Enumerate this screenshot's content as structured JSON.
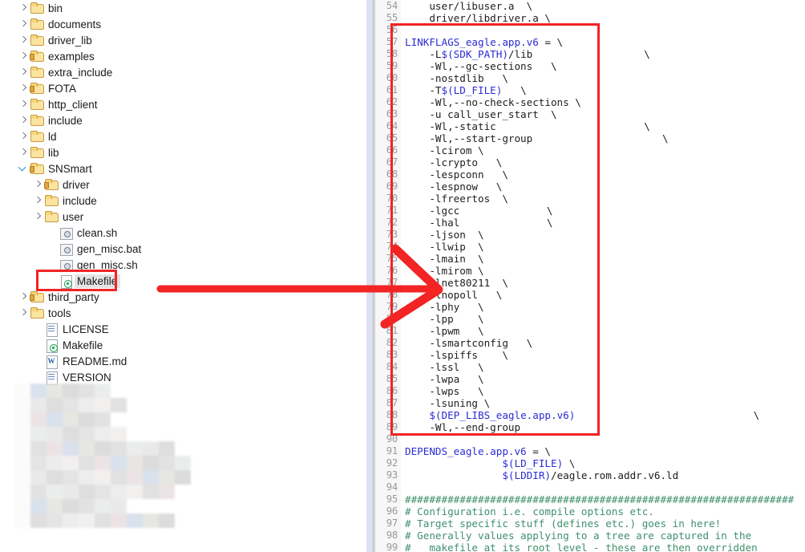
{
  "file_tree": {
    "name": "project-file-tree",
    "items": [
      {
        "label": "bin",
        "indent": 1,
        "icon": "folder-icon",
        "twisty": "closed",
        "selected": false
      },
      {
        "label": "documents",
        "indent": 1,
        "icon": "folder-icon",
        "twisty": "closed",
        "selected": false
      },
      {
        "label": "driver_lib",
        "indent": 1,
        "icon": "folder-icon",
        "twisty": "closed",
        "selected": false
      },
      {
        "label": "examples",
        "indent": 1,
        "icon": "folder-open-icon",
        "twisty": "closed",
        "selected": false
      },
      {
        "label": "extra_include",
        "indent": 1,
        "icon": "folder-icon",
        "twisty": "closed",
        "selected": false
      },
      {
        "label": "FOTA",
        "indent": 1,
        "icon": "folder-open-icon",
        "twisty": "closed",
        "selected": false
      },
      {
        "label": "http_client",
        "indent": 1,
        "icon": "folder-icon",
        "twisty": "closed",
        "selected": false
      },
      {
        "label": "include",
        "indent": 1,
        "icon": "folder-icon",
        "twisty": "closed",
        "selected": false
      },
      {
        "label": "ld",
        "indent": 1,
        "icon": "folder-icon",
        "twisty": "closed",
        "selected": false
      },
      {
        "label": "lib",
        "indent": 1,
        "icon": "folder-icon",
        "twisty": "closed",
        "selected": false
      },
      {
        "label": "SNSmart",
        "indent": 1,
        "icon": "folder-open-icon",
        "twisty": "open",
        "selected": false
      },
      {
        "label": "driver",
        "indent": 2,
        "icon": "folder-open-icon",
        "twisty": "closed",
        "selected": false
      },
      {
        "label": "include",
        "indent": 2,
        "icon": "folder-icon",
        "twisty": "closed",
        "selected": false
      },
      {
        "label": "user",
        "indent": 2,
        "icon": "folder-icon",
        "twisty": "closed",
        "selected": false
      },
      {
        "label": "clean.sh",
        "indent": 3,
        "icon": "script-icon",
        "twisty": "none",
        "selected": false
      },
      {
        "label": "gen_misc.bat",
        "indent": 3,
        "icon": "script-icon",
        "twisty": "none",
        "selected": false
      },
      {
        "label": "gen_misc.sh",
        "indent": 3,
        "icon": "script-icon",
        "twisty": "none",
        "selected": false
      },
      {
        "label": "Makefile",
        "indent": 3,
        "icon": "makefile-icon",
        "twisty": "none",
        "selected": true
      },
      {
        "label": "third_party",
        "indent": 1,
        "icon": "folder-open-icon",
        "twisty": "closed",
        "selected": false
      },
      {
        "label": "tools",
        "indent": 1,
        "icon": "folder-icon",
        "twisty": "closed",
        "selected": false
      },
      {
        "label": "LICENSE",
        "indent": 2,
        "icon": "document-icon",
        "twisty": "none",
        "selected": false
      },
      {
        "label": "Makefile",
        "indent": 2,
        "icon": "makefile-icon",
        "twisty": "none",
        "selected": false
      },
      {
        "label": "README.md",
        "indent": 2,
        "icon": "markdown-icon",
        "twisty": "none",
        "selected": false
      },
      {
        "label": "VERSION",
        "indent": 2,
        "icon": "document-icon",
        "twisty": "none",
        "selected": false
      }
    ]
  },
  "annotations": {
    "highlight_color": "#f22424",
    "makefile_box_label": "Makefile",
    "arrow_label": "pointer-arrow-to-lnopoll"
  },
  "editor": {
    "name": "makefile-source-view",
    "language": "makefile",
    "first_visible_line": 54,
    "last_visible_line": 99,
    "lines": [
      {
        "n": 54,
        "text": "    user/libuser.a  \\"
      },
      {
        "n": 55,
        "text": "    driver/libdriver.a \\"
      },
      {
        "n": 56,
        "text": ""
      },
      {
        "n": 57,
        "text": "LINKFLAGS_eagle.app.v6 = \\",
        "kw_end": 22
      },
      {
        "n": 58,
        "text": "    -L$(SDK_PATH)/lib",
        "cont": "\\",
        "cont_col": 40
      },
      {
        "n": 59,
        "text": "    -Wl,--gc-sections   \\"
      },
      {
        "n": 60,
        "text": "    -nostdlib   \\"
      },
      {
        "n": 61,
        "text": "    -T$(LD_FILE)   \\"
      },
      {
        "n": 62,
        "text": "    -Wl,--no-check-sections \\"
      },
      {
        "n": 63,
        "text": "    -u call_user_start  \\"
      },
      {
        "n": 64,
        "text": "    -Wl,-static",
        "cont": "\\",
        "cont_col": 40
      },
      {
        "n": 65,
        "text": "    -Wl,--start-group",
        "cont": "\\",
        "cont_col": 43
      },
      {
        "n": 66,
        "text": "    -lcirom \\"
      },
      {
        "n": 67,
        "text": "    -lcrypto   \\"
      },
      {
        "n": 68,
        "text": "    -lespconn   \\"
      },
      {
        "n": 69,
        "text": "    -lespnow   \\"
      },
      {
        "n": 70,
        "text": "    -lfreertos  \\"
      },
      {
        "n": 71,
        "text": "    -lgcc",
        "cont": "\\",
        "cont_col": 24
      },
      {
        "n": 72,
        "text": "    -lhal",
        "cont": "\\",
        "cont_col": 24
      },
      {
        "n": 73,
        "text": "    -ljson  \\"
      },
      {
        "n": 74,
        "text": "    -llwip  \\"
      },
      {
        "n": 75,
        "text": "    -lmain  \\"
      },
      {
        "n": 76,
        "text": "    -lmirom \\"
      },
      {
        "n": 77,
        "text": "    -lnet80211  \\"
      },
      {
        "n": 78,
        "text": "    -lnopoll   \\"
      },
      {
        "n": 79,
        "text": "    -lphy   \\"
      },
      {
        "n": 80,
        "text": "    -lpp    \\"
      },
      {
        "n": 81,
        "text": "    -lpwm   \\"
      },
      {
        "n": 82,
        "text": "    -lsmartconfig   \\"
      },
      {
        "n": 83,
        "text": "    -lspiffs    \\"
      },
      {
        "n": 84,
        "text": "    -lssl   \\"
      },
      {
        "n": 85,
        "text": "    -lwpa   \\"
      },
      {
        "n": 86,
        "text": "    -lwps   \\"
      },
      {
        "n": 87,
        "text": "    -lsuning \\"
      },
      {
        "n": 88,
        "text": "    $(DEP_LIBS_eagle.app.v6)",
        "var": true,
        "cont": "\\",
        "cont_col": 58
      },
      {
        "n": 89,
        "text": "    -Wl,--end-group"
      },
      {
        "n": 90,
        "text": ""
      },
      {
        "n": 91,
        "text": "DEPENDS_eagle.app.v6 = \\",
        "kw_end": 20
      },
      {
        "n": 92,
        "text": "                $(LD_FILE) \\",
        "var": true
      },
      {
        "n": 93,
        "text": "                $(LDDIR)/eagle.rom.addr.v6.ld",
        "var": true
      },
      {
        "n": 94,
        "text": ""
      },
      {
        "n": 95,
        "text": "################################################################",
        "comment": true
      },
      {
        "n": 96,
        "text": "# Configuration i.e. compile options etc.",
        "comment": true
      },
      {
        "n": 97,
        "text": "# Target specific stuff (defines etc.) goes in here!",
        "comment": true
      },
      {
        "n": 98,
        "text": "# Generally values applying to a tree are captured in the",
        "comment": true
      },
      {
        "n": 99,
        "text": "#   makefile at its root level - these are then overridden",
        "comment": true
      }
    ]
  },
  "colors": {
    "keyword": "#2b2bd4",
    "variable": "#2b2bd4",
    "comment": "#3f8f6e",
    "line_number": "#9a9a9a",
    "text": "#1d1d1d",
    "annotation_red": "#f22424",
    "selection": "#e4e4e4"
  }
}
